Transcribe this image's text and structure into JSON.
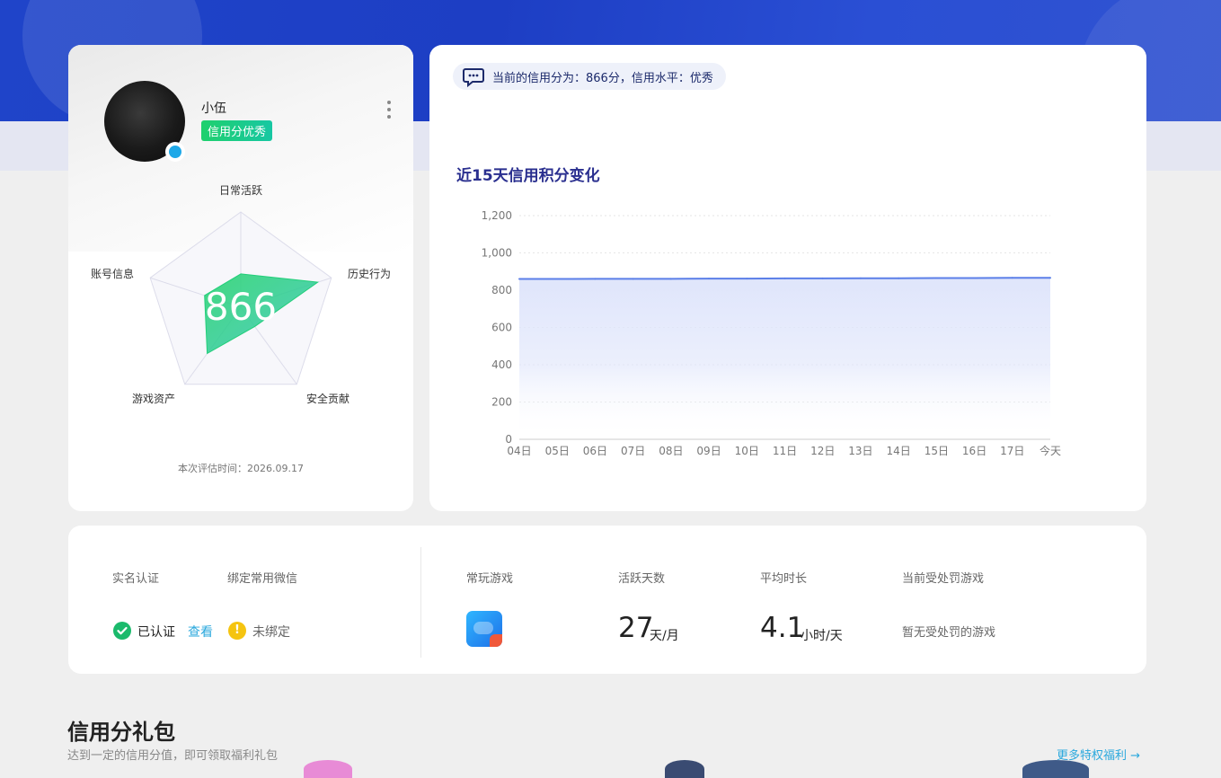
{
  "profile": {
    "name": "小伍",
    "credit_tag": "信用分优秀",
    "score_display": "866",
    "radar": {
      "axes": [
        "日常活跃",
        "历史行为",
        "安全贡献",
        "游戏资产",
        "账号信息"
      ],
      "values": [
        0.35,
        0.85,
        0.25,
        0.6,
        0.4
      ]
    },
    "eval_time": "本次评估时间：2026.09.17"
  },
  "notice": {
    "text": "当前的信用分为：866分，信用水平：优秀"
  },
  "chart_data": {
    "type": "area",
    "title": "近15天信用积分变化",
    "categories": [
      "04日",
      "05日",
      "06日",
      "07日",
      "08日",
      "09日",
      "10日",
      "11日",
      "12日",
      "13日",
      "14日",
      "15日",
      "16日",
      "17日",
      "今天"
    ],
    "values": [
      860,
      860,
      861,
      861,
      861,
      862,
      862,
      863,
      863,
      864,
      864,
      865,
      865,
      866,
      866
    ],
    "ylim": [
      0,
      1200
    ],
    "yticks": [
      "0",
      "200",
      "400",
      "600",
      "800",
      "1,000",
      "1,200"
    ],
    "grid": true,
    "colors": {
      "line": "#5b7fe8",
      "fill_top": "#dfe5fb"
    }
  },
  "info": {
    "real_name_label": "实名认证",
    "real_name_status": "已认证",
    "view_link": "查看",
    "wechat_label": "绑定常用微信",
    "wechat_status": "未绑定",
    "frequent_games_label": "常玩游戏",
    "active_days_label": "活跃天数",
    "active_days_value": "27",
    "active_days_unit": "天/月",
    "avg_duration_label": "平均时长",
    "avg_duration_value": "4.1",
    "avg_duration_unit": "小时/天",
    "punished_label": "当前受处罚游戏",
    "punished_value": "暂无受处罚的游戏"
  },
  "gifts": {
    "title": "信用分礼包",
    "subtitle": "达到一定的信用分值，即可领取福利礼包",
    "more_link": "更多特权福利 →"
  }
}
